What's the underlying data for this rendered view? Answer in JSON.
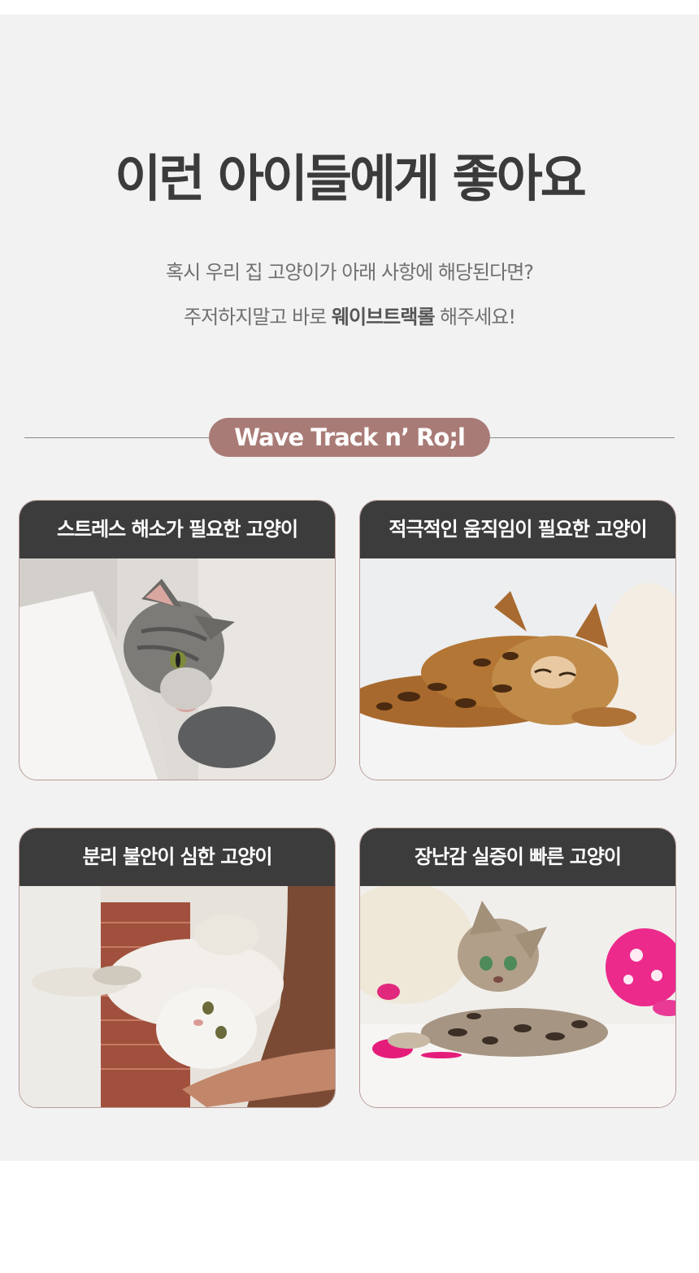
{
  "header": {
    "title": "이런 아이들에게 좋아요",
    "subtitle_line1": "혹시 우리 집 고양이가 아래 사항에 해당된다면?",
    "subtitle_line2_prefix": "주저하지말고 바로 ",
    "subtitle_line2_brand": "웨이브트랙롤",
    "subtitle_line2_suffix": " 해주세요!"
  },
  "badge": {
    "label": "Wave Track n’ Ro;l"
  },
  "cards": [
    {
      "title": "스트레스 해소가 필요한 고양이",
      "photo": "gray-tabby-cat-resting-on-white-ledge"
    },
    {
      "title": "적극적인 움직임이 필요한 고양이",
      "photo": "bengal-cat-sleeping-on-white-blanket"
    },
    {
      "title": "분리 불안이 심한 고양이",
      "photo": "fluffy-white-cat-held-upside-down"
    },
    {
      "title": "장난감 실증이 빠른 고양이",
      "photo": "bengal-kitten-with-pink-toys"
    }
  ],
  "colors": {
    "panel_bg": "#f2f2f2",
    "headline": "#3b3b3b",
    "badge_bg": "#a97b76",
    "card_header_bg": "#3c3c3c",
    "card_border": "#b89a97"
  }
}
